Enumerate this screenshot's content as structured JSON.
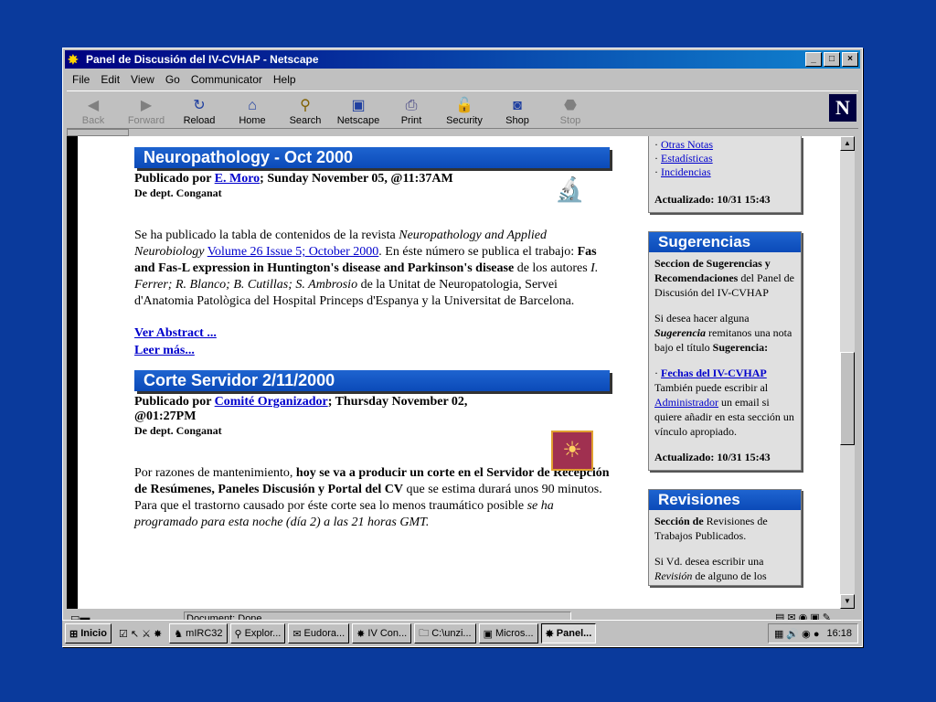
{
  "window": {
    "title": "Panel de Discusión del IV-CVHAP - Netscape",
    "menus": [
      "File",
      "Edit",
      "View",
      "Go",
      "Communicator",
      "Help"
    ],
    "toolbar": [
      "Back",
      "Forward",
      "Reload",
      "Home",
      "Search",
      "Netscape",
      "Print",
      "Security",
      "Shop",
      "Stop"
    ],
    "status": "Document: Done"
  },
  "articles": [
    {
      "title": "Neuropathology - Oct 2000",
      "by_prefix": "Publicado por ",
      "author": "E. Moro",
      "date": "; Sunday November 05, @11:37AM",
      "dept": "De dept. Conganat",
      "p1": "Se ha publicado la tabla de contenidos de la revista ",
      "p2": "Neuropathology and Applied Neurobiology",
      "p3": "Volume 26 Issue 5; October 2000",
      "p4": ". En éste número se publica el trabajo: ",
      "p5": "Fas and Fas-L expression in Huntington's disease and Parkinson's disease",
      "p6": " de los autores ",
      "p7": "I. Ferrer; R. Blanco; B. Cutillas; S. Ambrosio",
      "p8": " de la Unitat de Neuropatologia, Servei d'Anatomia Patològica del Hospital Princeps d'Espanya y la Universitat de Barcelona.",
      "link1": "Ver Abstract ...",
      "link2": "Leer más..."
    },
    {
      "title": "Corte Servidor 2/11/2000",
      "by_prefix": "Publicado por ",
      "author": "Comité Organizador",
      "date": "; Thursday November 02, @01:27PM",
      "dept": "De dept. Conganat",
      "p1": "Por razones de mantenimiento, ",
      "p2": "hoy se va a producir un corte en el Servidor de Recepción de Resúmenes, Paneles Discusión y Portal del CV",
      "p3": " que se estima durará unos 90 minutos. Para que el trastorno causado por éste corte sea lo menos traumático posible ",
      "p4": "se ha programado para esta noche (día 2) a las 21 horas GMT."
    }
  ],
  "sidebar": {
    "top_links": [
      "Otras Notas",
      "Estadísticas",
      "Incidencias"
    ],
    "top_updated": "Actualizado: 10/31 15:43",
    "sug": {
      "title": "Sugerencias",
      "t1": "Seccion de Sugerencias y Recomendaciones",
      "t2": " del Panel de Discusión del IV-CVHAP",
      "t3": "Si desea hacer alguna ",
      "t4": "Sugerencia",
      "t5": " remitanos una nota bajo el título ",
      "t6": "Sugerencia:",
      "link": "Fechas del IV-CVHAP",
      "t7": " También puede escribir al ",
      "admin": "Administrador",
      "t8": " un email si quiere añadir en esta sección un vínculo apropiado.",
      "updated": "Actualizado: 10/31 15:43"
    },
    "rev": {
      "title": "Revisiones",
      "t1": "Sección de",
      "t2": " Revisiones de Trabajos Publicados.",
      "t3": "Si Vd. desea escribir una ",
      "t4": "Revisión",
      "t5": " de alguno de los"
    }
  },
  "taskbar": {
    "start": "Inicio",
    "items": [
      "mIRC32",
      "Explor...",
      "Eudora...",
      "IV Con...",
      "C:\\unzi...",
      "Micros...",
      "Panel..."
    ],
    "clock": "16:18"
  }
}
